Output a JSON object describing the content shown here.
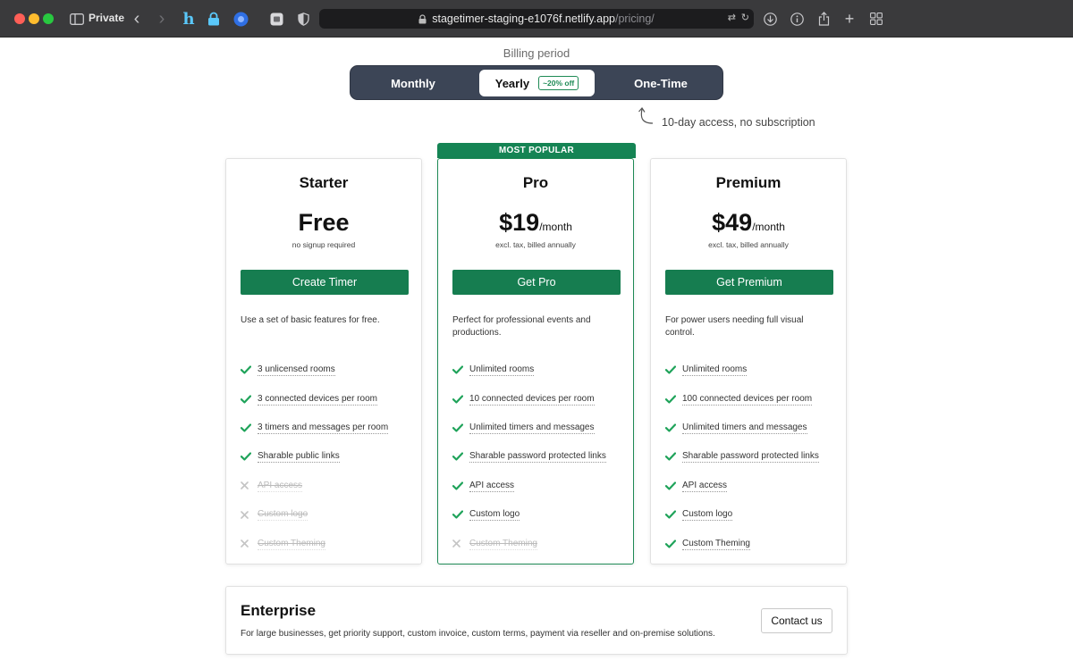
{
  "browser": {
    "private_label": "Private",
    "url_main": "stagetimer-staging-e1076f.netlify.app",
    "url_path": "/pricing/"
  },
  "billing": {
    "label": "Billing period",
    "options": [
      "Monthly",
      "Yearly",
      "One-Time"
    ],
    "selected": "Yearly",
    "discount_badge": "~20% off",
    "note": "10-day access, no subscription"
  },
  "plans": [
    {
      "name": "Starter",
      "price": "Free",
      "per": "",
      "price_sub": "no signup required",
      "cta": "Create Timer",
      "description": "Use a set of basic features for free.",
      "features": [
        {
          "text": "3 unlicensed rooms",
          "included": true
        },
        {
          "text": "3 connected devices per room",
          "included": true
        },
        {
          "text": "3 timers and messages per room",
          "included": true
        },
        {
          "text": "Sharable public links",
          "included": true
        },
        {
          "text": "API access",
          "included": false
        },
        {
          "text": "Custom logo",
          "included": false
        },
        {
          "text": "Custom Theming",
          "included": false
        }
      ]
    },
    {
      "name": "Pro",
      "price": "$19",
      "per": "/month",
      "price_sub": "excl. tax, billed annually",
      "cta": "Get Pro",
      "badge": "MOST POPULAR",
      "description": "Perfect for professional events and productions.",
      "features": [
        {
          "text": "Unlimited rooms",
          "included": true
        },
        {
          "text": "10 connected devices per room",
          "included": true
        },
        {
          "text": "Unlimited timers and messages",
          "included": true
        },
        {
          "text": "Sharable password protected links",
          "included": true
        },
        {
          "text": "API access",
          "included": true
        },
        {
          "text": "Custom logo",
          "included": true
        },
        {
          "text": "Custom Theming",
          "included": false
        }
      ]
    },
    {
      "name": "Premium",
      "price": "$49",
      "per": "/month",
      "price_sub": "excl. tax, billed annually",
      "cta": "Get Premium",
      "description": "For power users needing full visual control.",
      "features": [
        {
          "text": "Unlimited rooms",
          "included": true
        },
        {
          "text": "100 connected devices per room",
          "included": true
        },
        {
          "text": "Unlimited timers and messages",
          "included": true
        },
        {
          "text": "Sharable password protected links",
          "included": true
        },
        {
          "text": "API access",
          "included": true
        },
        {
          "text": "Custom logo",
          "included": true
        },
        {
          "text": "Custom Theming",
          "included": true
        }
      ]
    }
  ],
  "enterprise": {
    "title": "Enterprise",
    "description": "For large businesses, get priority support, custom invoice, custom terms, payment via reseller and on-premise solutions.",
    "cta": "Contact us"
  },
  "colors": {
    "accent": "#167d50",
    "check": "#1fa35a",
    "segment_bg": "#3c4556"
  }
}
